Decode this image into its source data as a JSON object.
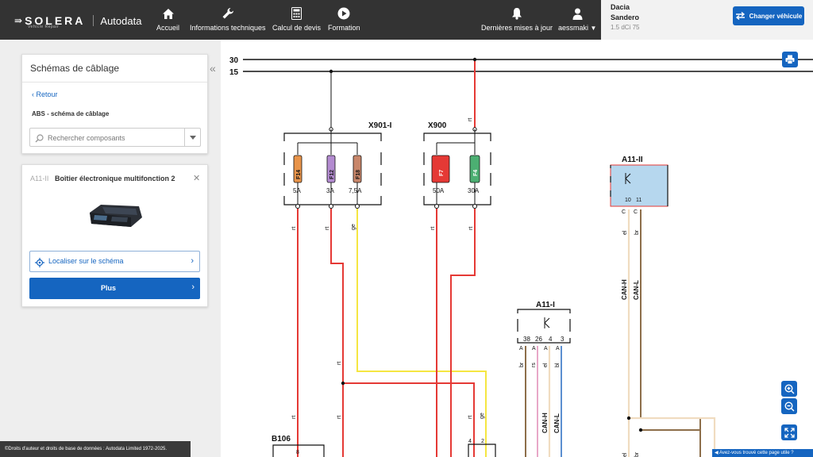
{
  "header": {
    "logo_name": "SOLERA",
    "logo_sub": "Vehicle Repair",
    "brand": "Autodata",
    "nav": [
      {
        "label": "Accueil",
        "icon": "home-icon"
      },
      {
        "label": "Informations techniques",
        "icon": "wrench-icon"
      },
      {
        "label": "Calcul de devis",
        "icon": "calculator-icon"
      },
      {
        "label": "Formation",
        "icon": "play-icon"
      },
      {
        "label": "Dernières mises à jour",
        "icon": "bell-icon"
      },
      {
        "label": "aessmaki",
        "icon": "user-icon"
      }
    ]
  },
  "vehicle": {
    "make": "Dacia",
    "model": "Sandero",
    "engine": "1.5 dCi 75",
    "change_label": "Changer véhicule"
  },
  "sidebar": {
    "title": "Schémas de câblage",
    "back_label": "Retour",
    "schema_name": "ABS - schéma de câblage",
    "search_placeholder": "Rechercher composants"
  },
  "component": {
    "code": "A11-II",
    "name": "Boîtier électronique multifonction 2",
    "locate_label": "Localiser sur le schéma",
    "more_label": "Plus"
  },
  "footer": {
    "copyright": "©Droits d'auteur et droits de base de données : Autodata Limited 1972-2025.",
    "feedback": "◀ Avez-vous trouvé cette page utile ?"
  },
  "colors": {
    "accent": "#1565c0",
    "topbar": "#333333",
    "wire_red": "#e53935",
    "wire_yellow": "#f5e642",
    "wire_brown": "#8d6e4a",
    "wire_pink": "#e8a8c8",
    "wire_blue": "#5b8fd0",
    "wire_cream": "#f0dcc0"
  },
  "diagram": {
    "rails": [
      "30",
      "15"
    ],
    "connectors": [
      "X901-I",
      "X900",
      "A11-II",
      "A11-I",
      "B106"
    ],
    "fuses_x901": [
      {
        "id": "F14",
        "rating": "5A",
        "color": "#e8944a"
      },
      {
        "id": "F12",
        "rating": "3A",
        "color": "#b38bd0"
      },
      {
        "id": "F18",
        "rating": "7,5A",
        "color": "#c8866a"
      }
    ],
    "fuses_x900": [
      {
        "id": "F7",
        "rating": "50A",
        "color": "#e53935"
      },
      {
        "id": "F4",
        "rating": "30A",
        "color": "#4caf72"
      }
    ],
    "a11_ii_pins": [
      "10",
      "11"
    ],
    "a11_ii_pin_letters": [
      "C",
      "C"
    ],
    "a11_i_pins": [
      "38",
      "26",
      "4",
      "3"
    ],
    "a11_i_pin_letters": [
      "A",
      "A",
      "A",
      "A"
    ],
    "b106_pin": "8",
    "right_pins": [
      "4",
      "2"
    ],
    "wire_codes": [
      "rt",
      "ge",
      "el",
      "br",
      "rs",
      "bl"
    ],
    "signals": [
      "CAN-H",
      "CAN-L"
    ]
  }
}
